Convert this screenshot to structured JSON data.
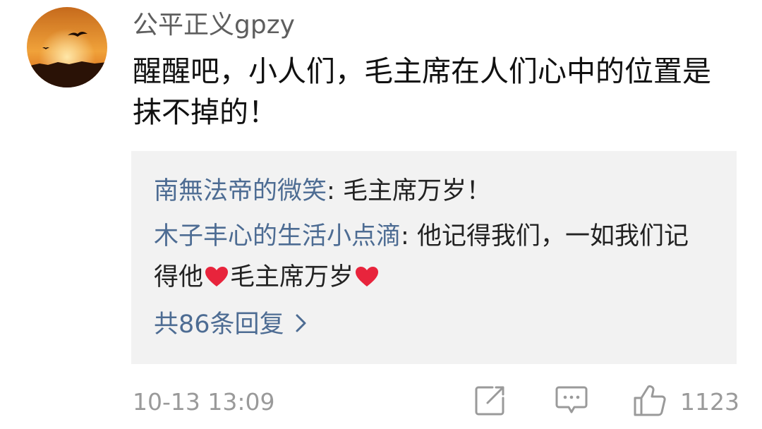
{
  "comment": {
    "username": "公平正义gpzy",
    "text": "醒醒吧，小人们，毛主席在人们心中的位置是抹不掉的！",
    "avatar_icon": "sunset-bird-avatar"
  },
  "replies": [
    {
      "name": "南無法帝的微笑",
      "separator": ": ",
      "text_before": "毛主席万岁！",
      "text_mid": "",
      "text_after": ""
    },
    {
      "name": "木子丰心的生活小点滴",
      "separator": ": ",
      "text_before": "他记得我们，一如我们记得他",
      "text_mid": "毛主席万岁",
      "text_after": ""
    }
  ],
  "reply_count_label": "共86条回复",
  "footer": {
    "time": "10-13 13:09",
    "like_count": "1123"
  },
  "colors": {
    "link": "#4d6c93",
    "text": "#111111",
    "muted": "#9a9a9a",
    "reply_bg": "#f2f2f2",
    "heart": "#e8243c"
  },
  "icons": [
    "share-icon",
    "comment-icon",
    "like-icon",
    "heart-icon",
    "chevron-right-icon"
  ]
}
